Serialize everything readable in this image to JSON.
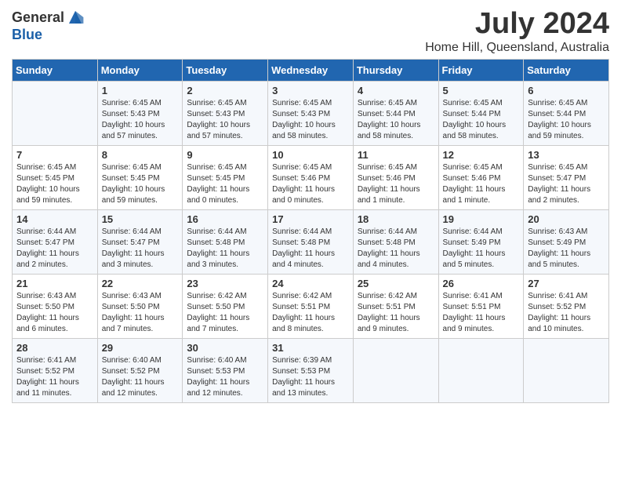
{
  "logo": {
    "general": "General",
    "blue": "Blue"
  },
  "title": "July 2024",
  "location": "Home Hill, Queensland, Australia",
  "days_of_week": [
    "Sunday",
    "Monday",
    "Tuesday",
    "Wednesday",
    "Thursday",
    "Friday",
    "Saturday"
  ],
  "weeks": [
    [
      {
        "num": "",
        "sunrise": "",
        "sunset": "",
        "daylight": ""
      },
      {
        "num": "1",
        "sunrise": "Sunrise: 6:45 AM",
        "sunset": "Sunset: 5:43 PM",
        "daylight": "Daylight: 10 hours and 57 minutes."
      },
      {
        "num": "2",
        "sunrise": "Sunrise: 6:45 AM",
        "sunset": "Sunset: 5:43 PM",
        "daylight": "Daylight: 10 hours and 57 minutes."
      },
      {
        "num": "3",
        "sunrise": "Sunrise: 6:45 AM",
        "sunset": "Sunset: 5:43 PM",
        "daylight": "Daylight: 10 hours and 58 minutes."
      },
      {
        "num": "4",
        "sunrise": "Sunrise: 6:45 AM",
        "sunset": "Sunset: 5:44 PM",
        "daylight": "Daylight: 10 hours and 58 minutes."
      },
      {
        "num": "5",
        "sunrise": "Sunrise: 6:45 AM",
        "sunset": "Sunset: 5:44 PM",
        "daylight": "Daylight: 10 hours and 58 minutes."
      },
      {
        "num": "6",
        "sunrise": "Sunrise: 6:45 AM",
        "sunset": "Sunset: 5:44 PM",
        "daylight": "Daylight: 10 hours and 59 minutes."
      }
    ],
    [
      {
        "num": "7",
        "sunrise": "Sunrise: 6:45 AM",
        "sunset": "Sunset: 5:45 PM",
        "daylight": "Daylight: 10 hours and 59 minutes."
      },
      {
        "num": "8",
        "sunrise": "Sunrise: 6:45 AM",
        "sunset": "Sunset: 5:45 PM",
        "daylight": "Daylight: 10 hours and 59 minutes."
      },
      {
        "num": "9",
        "sunrise": "Sunrise: 6:45 AM",
        "sunset": "Sunset: 5:45 PM",
        "daylight": "Daylight: 11 hours and 0 minutes."
      },
      {
        "num": "10",
        "sunrise": "Sunrise: 6:45 AM",
        "sunset": "Sunset: 5:46 PM",
        "daylight": "Daylight: 11 hours and 0 minutes."
      },
      {
        "num": "11",
        "sunrise": "Sunrise: 6:45 AM",
        "sunset": "Sunset: 5:46 PM",
        "daylight": "Daylight: 11 hours and 1 minute."
      },
      {
        "num": "12",
        "sunrise": "Sunrise: 6:45 AM",
        "sunset": "Sunset: 5:46 PM",
        "daylight": "Daylight: 11 hours and 1 minute."
      },
      {
        "num": "13",
        "sunrise": "Sunrise: 6:45 AM",
        "sunset": "Sunset: 5:47 PM",
        "daylight": "Daylight: 11 hours and 2 minutes."
      }
    ],
    [
      {
        "num": "14",
        "sunrise": "Sunrise: 6:44 AM",
        "sunset": "Sunset: 5:47 PM",
        "daylight": "Daylight: 11 hours and 2 minutes."
      },
      {
        "num": "15",
        "sunrise": "Sunrise: 6:44 AM",
        "sunset": "Sunset: 5:47 PM",
        "daylight": "Daylight: 11 hours and 3 minutes."
      },
      {
        "num": "16",
        "sunrise": "Sunrise: 6:44 AM",
        "sunset": "Sunset: 5:48 PM",
        "daylight": "Daylight: 11 hours and 3 minutes."
      },
      {
        "num": "17",
        "sunrise": "Sunrise: 6:44 AM",
        "sunset": "Sunset: 5:48 PM",
        "daylight": "Daylight: 11 hours and 4 minutes."
      },
      {
        "num": "18",
        "sunrise": "Sunrise: 6:44 AM",
        "sunset": "Sunset: 5:48 PM",
        "daylight": "Daylight: 11 hours and 4 minutes."
      },
      {
        "num": "19",
        "sunrise": "Sunrise: 6:44 AM",
        "sunset": "Sunset: 5:49 PM",
        "daylight": "Daylight: 11 hours and 5 minutes."
      },
      {
        "num": "20",
        "sunrise": "Sunrise: 6:43 AM",
        "sunset": "Sunset: 5:49 PM",
        "daylight": "Daylight: 11 hours and 5 minutes."
      }
    ],
    [
      {
        "num": "21",
        "sunrise": "Sunrise: 6:43 AM",
        "sunset": "Sunset: 5:50 PM",
        "daylight": "Daylight: 11 hours and 6 minutes."
      },
      {
        "num": "22",
        "sunrise": "Sunrise: 6:43 AM",
        "sunset": "Sunset: 5:50 PM",
        "daylight": "Daylight: 11 hours and 7 minutes."
      },
      {
        "num": "23",
        "sunrise": "Sunrise: 6:42 AM",
        "sunset": "Sunset: 5:50 PM",
        "daylight": "Daylight: 11 hours and 7 minutes."
      },
      {
        "num": "24",
        "sunrise": "Sunrise: 6:42 AM",
        "sunset": "Sunset: 5:51 PM",
        "daylight": "Daylight: 11 hours and 8 minutes."
      },
      {
        "num": "25",
        "sunrise": "Sunrise: 6:42 AM",
        "sunset": "Sunset: 5:51 PM",
        "daylight": "Daylight: 11 hours and 9 minutes."
      },
      {
        "num": "26",
        "sunrise": "Sunrise: 6:41 AM",
        "sunset": "Sunset: 5:51 PM",
        "daylight": "Daylight: 11 hours and 9 minutes."
      },
      {
        "num": "27",
        "sunrise": "Sunrise: 6:41 AM",
        "sunset": "Sunset: 5:52 PM",
        "daylight": "Daylight: 11 hours and 10 minutes."
      }
    ],
    [
      {
        "num": "28",
        "sunrise": "Sunrise: 6:41 AM",
        "sunset": "Sunset: 5:52 PM",
        "daylight": "Daylight: 11 hours and 11 minutes."
      },
      {
        "num": "29",
        "sunrise": "Sunrise: 6:40 AM",
        "sunset": "Sunset: 5:52 PM",
        "daylight": "Daylight: 11 hours and 12 minutes."
      },
      {
        "num": "30",
        "sunrise": "Sunrise: 6:40 AM",
        "sunset": "Sunset: 5:53 PM",
        "daylight": "Daylight: 11 hours and 12 minutes."
      },
      {
        "num": "31",
        "sunrise": "Sunrise: 6:39 AM",
        "sunset": "Sunset: 5:53 PM",
        "daylight": "Daylight: 11 hours and 13 minutes."
      },
      {
        "num": "",
        "sunrise": "",
        "sunset": "",
        "daylight": ""
      },
      {
        "num": "",
        "sunrise": "",
        "sunset": "",
        "daylight": ""
      },
      {
        "num": "",
        "sunrise": "",
        "sunset": "",
        "daylight": ""
      }
    ]
  ]
}
